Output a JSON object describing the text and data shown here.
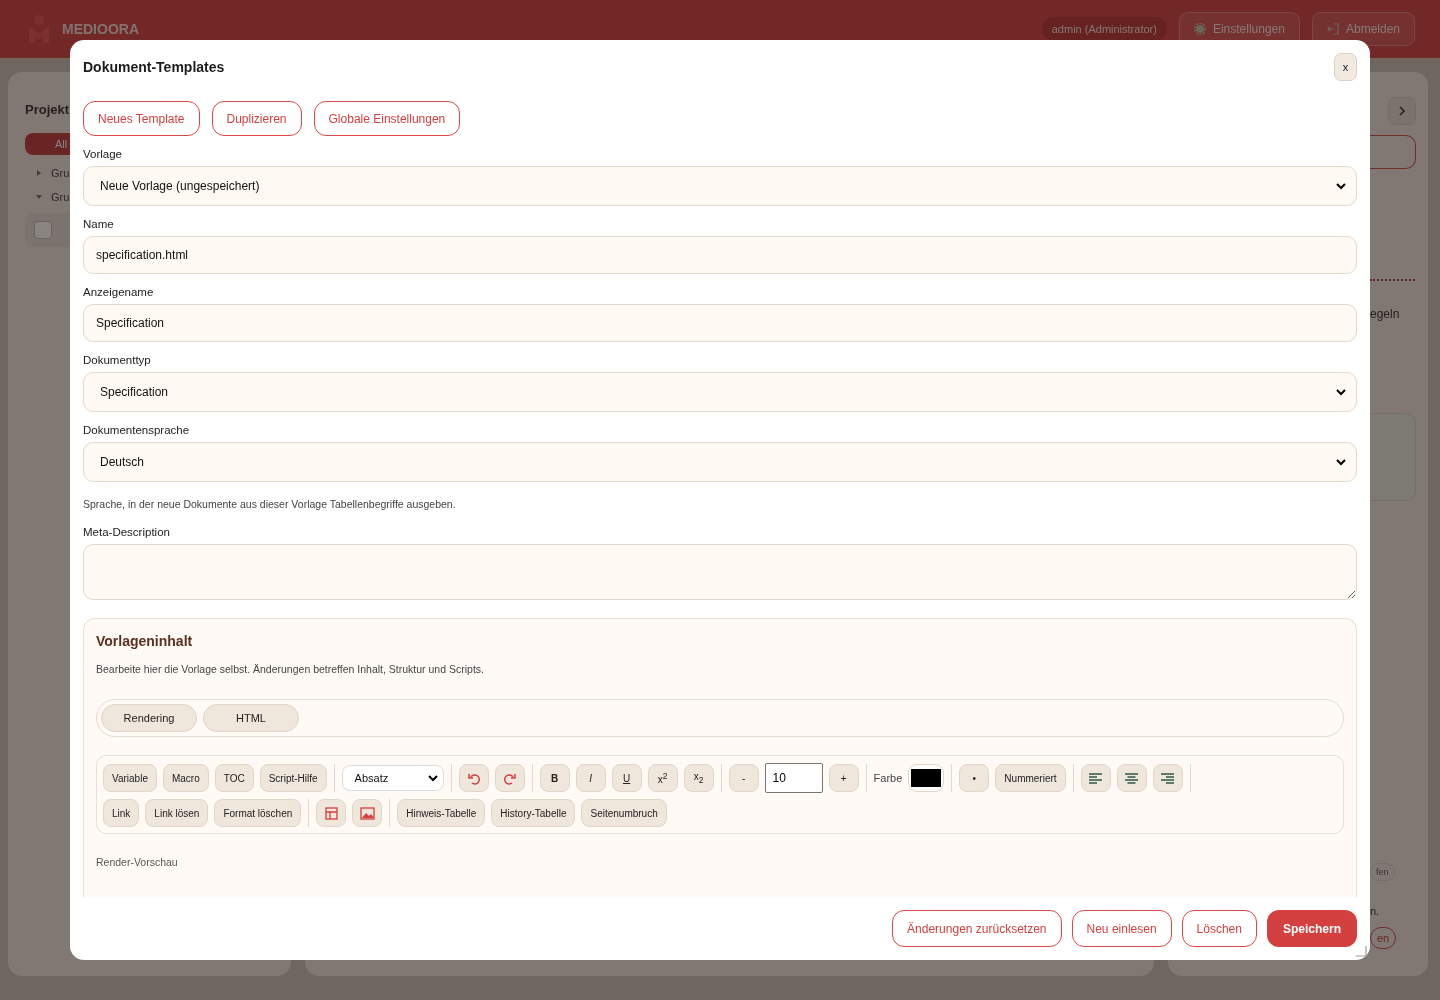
{
  "app": {
    "brand": "MEDIOORA",
    "user": "admin (Administrator)",
    "header_buttons": [
      {
        "kind": "gear",
        "label": "Einstellungen"
      },
      {
        "kind": "logout",
        "label": "Abmelden"
      }
    ],
    "left_panel": {
      "title": "Projekt",
      "filter": "All",
      "tree": [
        {
          "label": "Gru",
          "expanded": false
        },
        {
          "label": "Gru",
          "expanded": true
        }
      ],
      "checkbox": {
        "checked": false
      }
    },
    "right_panel": {
      "rule_label": "egeln",
      "tag": "fen",
      "note": "n.",
      "button": "en"
    }
  },
  "modal": {
    "title": "Dokument-Templates",
    "close": "x",
    "actions": [
      "Neues Template",
      "Duplizieren",
      "Globale Einstellungen"
    ],
    "fields": [
      {
        "kind": "select",
        "label": "Vorlage",
        "value": "Neue Vorlage (ungespeichert)"
      },
      {
        "kind": "input",
        "label": "Name",
        "value": "specification.html"
      },
      {
        "kind": "input",
        "label": "Anzeigename",
        "value": "Specification"
      },
      {
        "kind": "select",
        "label": "Dokumenttyp",
        "value": "Specification"
      },
      {
        "kind": "select",
        "label": "Dokumentensprache",
        "value": "Deutsch",
        "hint": "Sprache, in der neue Dokumente aus dieser Vorlage Tabellenbegriffe ausgeben."
      },
      {
        "kind": "textarea",
        "label": "Meta-Description"
      }
    ],
    "content": {
      "title": "Vorlageninhalt",
      "description": "Bearbeite hier die Vorlage selbst. Änderungen betreffen Inhalt, Struktur und Scripts.",
      "tabs": [
        "Rendering",
        "HTML"
      ],
      "toolbar": [
        [
          {
            "kind": "text",
            "label": "Variable"
          },
          {
            "kind": "text",
            "label": "Macro"
          },
          {
            "kind": "text",
            "label": "TOC"
          },
          {
            "kind": "text",
            "label": "Script-Hilfe"
          },
          {
            "kind": "sep"
          },
          {
            "kind": "select",
            "label": "Absatz"
          },
          {
            "kind": "sep"
          },
          {
            "kind": "undo"
          },
          {
            "kind": "redo"
          },
          {
            "kind": "sep"
          },
          {
            "kind": "bold",
            "label": "B"
          },
          {
            "kind": "italic",
            "label": "I"
          },
          {
            "kind": "underline",
            "label": "U"
          },
          {
            "kind": "small",
            "label": "x$^{2}$"
          },
          {
            "kind": "small",
            "label": "x$_{2}$"
          },
          {
            "kind": "sep"
          },
          {
            "kind": "small",
            "label": "-"
          },
          {
            "kind": "number",
            "label": "10"
          },
          {
            "kind": "small",
            "label": "+"
          },
          {
            "kind": "sep"
          },
          {
            "kind": "label",
            "label": "Farbe"
          },
          {
            "kind": "color",
            "color": "#000000"
          },
          {
            "kind": "sep"
          },
          {
            "kind": "small",
            "label": "•"
          },
          {
            "kind": "text",
            "label": "Nummeriert"
          },
          {
            "kind": "sep"
          },
          {
            "kind": "align-left"
          },
          {
            "kind": "align-center"
          },
          {
            "kind": "align-right"
          },
          {
            "kind": "sep"
          }
        ],
        [
          {
            "kind": "text",
            "label": "Link"
          },
          {
            "kind": "text",
            "label": "Link lösen"
          },
          {
            "kind": "text",
            "label": "Format löschen"
          },
          {
            "kind": "sep"
          },
          {
            "kind": "table"
          },
          {
            "kind": "image"
          },
          {
            "kind": "sep"
          },
          {
            "kind": "text",
            "label": "Hinweis-Tabelle"
          },
          {
            "kind": "text",
            "label": "History-Tabelle"
          },
          {
            "kind": "text",
            "label": "Seitenumbruch"
          }
        ]
      ],
      "preview_label": "Render-Vorschau"
    },
    "footer": [
      {
        "kind": "outline",
        "label": "Änderungen zurücksetzen"
      },
      {
        "kind": "outline",
        "label": "Neu einlesen"
      },
      {
        "kind": "outline",
        "label": "Löschen"
      },
      {
        "kind": "primary",
        "label": "Speichern"
      }
    ]
  }
}
